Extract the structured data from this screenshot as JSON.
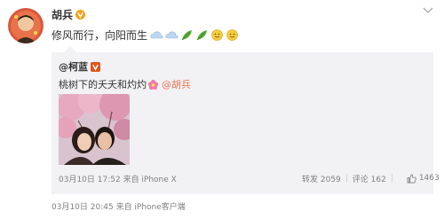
{
  "post": {
    "author": "胡兵",
    "verified_color": "#f7a11a",
    "text": "修风而行，向阳而生",
    "emojis": [
      "cloud-icon",
      "cloud-icon",
      "leaf-icon",
      "leaf-icon",
      "smile-face-icon",
      "smile-face-icon"
    ],
    "meta": "03月10日 20:45 来自 iPhone客户端"
  },
  "repost": {
    "author": "@柯蓝",
    "text": "桃树下的夭夭和灼灼",
    "mention": "@胡兵",
    "meta": "03月10日 17:52 来自 iPhone X",
    "reposts": "转发 2059",
    "comments": "评论 162",
    "likes": "1463"
  },
  "colors": {
    "mention": "#eb7350",
    "meta": "#808080",
    "card_bg": "#f2f2f5"
  }
}
